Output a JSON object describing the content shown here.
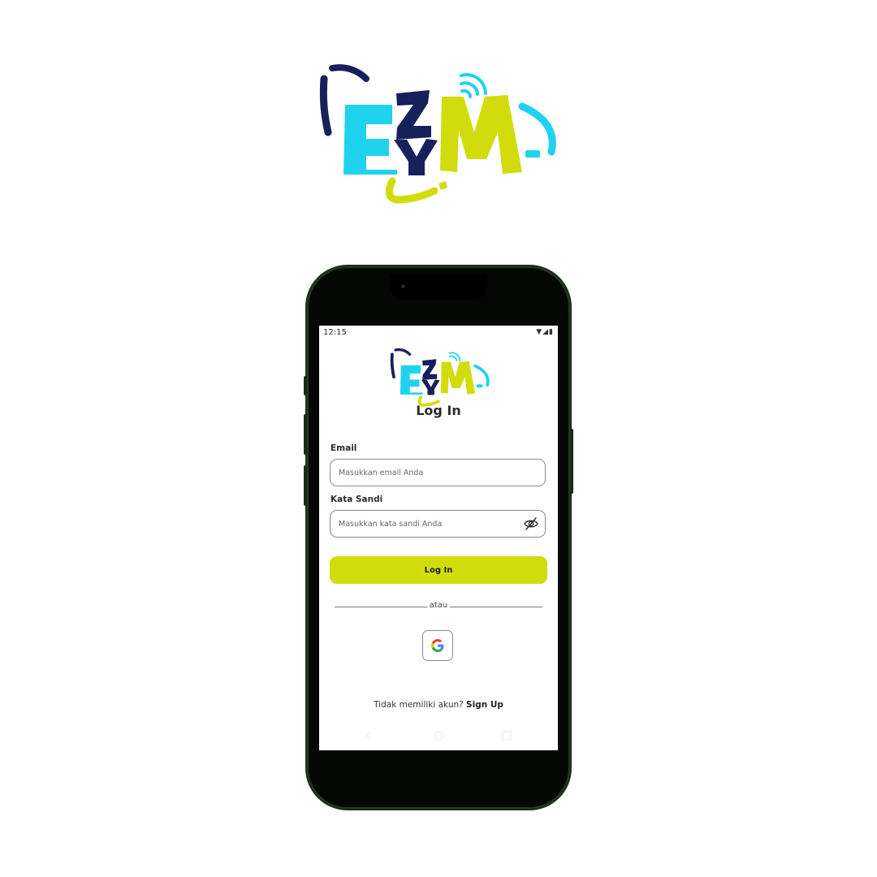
{
  "brand": {
    "logo_text": "EZYM",
    "colors": {
      "cyan": "#1fd3ee",
      "navy": "#16205a",
      "lime": "#d2dc0c"
    }
  },
  "status_bar": {
    "time": "12:15",
    "icons": "▼◢▮"
  },
  "screen": {
    "title": "Log In",
    "email": {
      "label": "Email",
      "placeholder": "Masukkan email Anda"
    },
    "password": {
      "label": "Kata Sandi",
      "placeholder": "Masukkan kata sandi Anda",
      "toggle_icon": "eye-off-icon"
    },
    "login_button": "Log In",
    "divider_text": "atau",
    "google_icon": "google-icon",
    "signup": {
      "prompt": "Tidak memiliki akun?",
      "link": "Sign Up"
    }
  },
  "colors": {
    "accent": "#d2dc0c",
    "phone_frame": "#1d3019"
  }
}
